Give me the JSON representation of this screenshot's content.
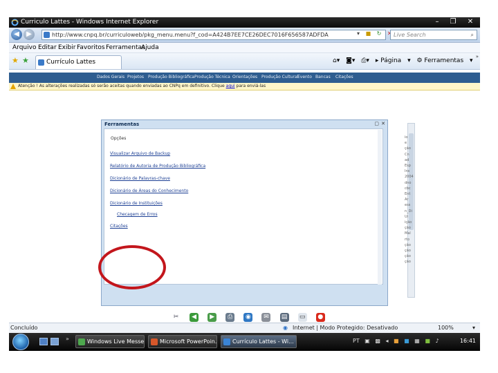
{
  "window": {
    "title": "Curriculo Lattes - Windows Internet Explorer",
    "controls": [
      "–",
      "❐",
      "✕"
    ]
  },
  "address_bar": {
    "url": "http://www.cnpq.br/curriculoweb/pkg_menu.menu?f_cod=A424B7EE7CE26DEC7016F656587ADFDA",
    "search_placeholder": "Live Search"
  },
  "menu": [
    "Arquivo",
    "Editar",
    "Exibir",
    "Favoritos",
    "Ferramentas",
    "Ajuda"
  ],
  "tab": {
    "label": "Currículo Lattes"
  },
  "command_bar": {
    "page": "Página",
    "tools": "Ferramentas"
  },
  "lattes_nav": [
    "Dados Gerais",
    "Projetos",
    "Produção Bibliográfica",
    "Produção Técnica",
    "Orientações",
    "Produção Cultural",
    "Evento",
    "Bancas",
    "Citações"
  ],
  "infobar": {
    "text": "Atenção ! As alterações realizadas só serão aceitas quando enviadas ao CNPq em definitivo. Clique",
    "link": "aqui",
    "suffix": "para enviá-las"
  },
  "dialog": {
    "title": "Ferramentas",
    "heading": "Opções",
    "options": [
      "Visualizar Arquivo de Backup",
      "Relatório de Autoria de Produção Bibliográfica",
      "Dicionário de Palavras-chave",
      "Dicionário de Áreas do Conhecimento",
      "Dicionário de Instituições",
      "Checagem de Erros",
      "Citações"
    ]
  },
  "background_fragments": [
    "io",
    "e",
    "ção",
    "Cn",
    "ad",
    "Esp",
    "Ins",
    "2004",
    "dno",
    "cbc",
    "Ent",
    "Ar",
    "ess",
    "n_Di",
    "Ui",
    "ição",
    "ção",
    "Mal",
    "rto",
    "ção",
    "ção",
    "ção",
    "ção"
  ],
  "status": {
    "left": "Concluído",
    "zone": "Internet | Modo Protegido: Desativado",
    "zoom": "100%"
  },
  "taskbar": {
    "items": [
      "Windows Live Messe...",
      "Microsoft PowerPoin...",
      "Currículo Lattes - Wi..."
    ],
    "lang": "PT",
    "time": "16:41"
  },
  "colors": {
    "lattes_nav_bg": "#2e5d90",
    "dialog_frame": "#cfe0f1",
    "link": "#1c3f94",
    "highlight": "#c3161c"
  }
}
